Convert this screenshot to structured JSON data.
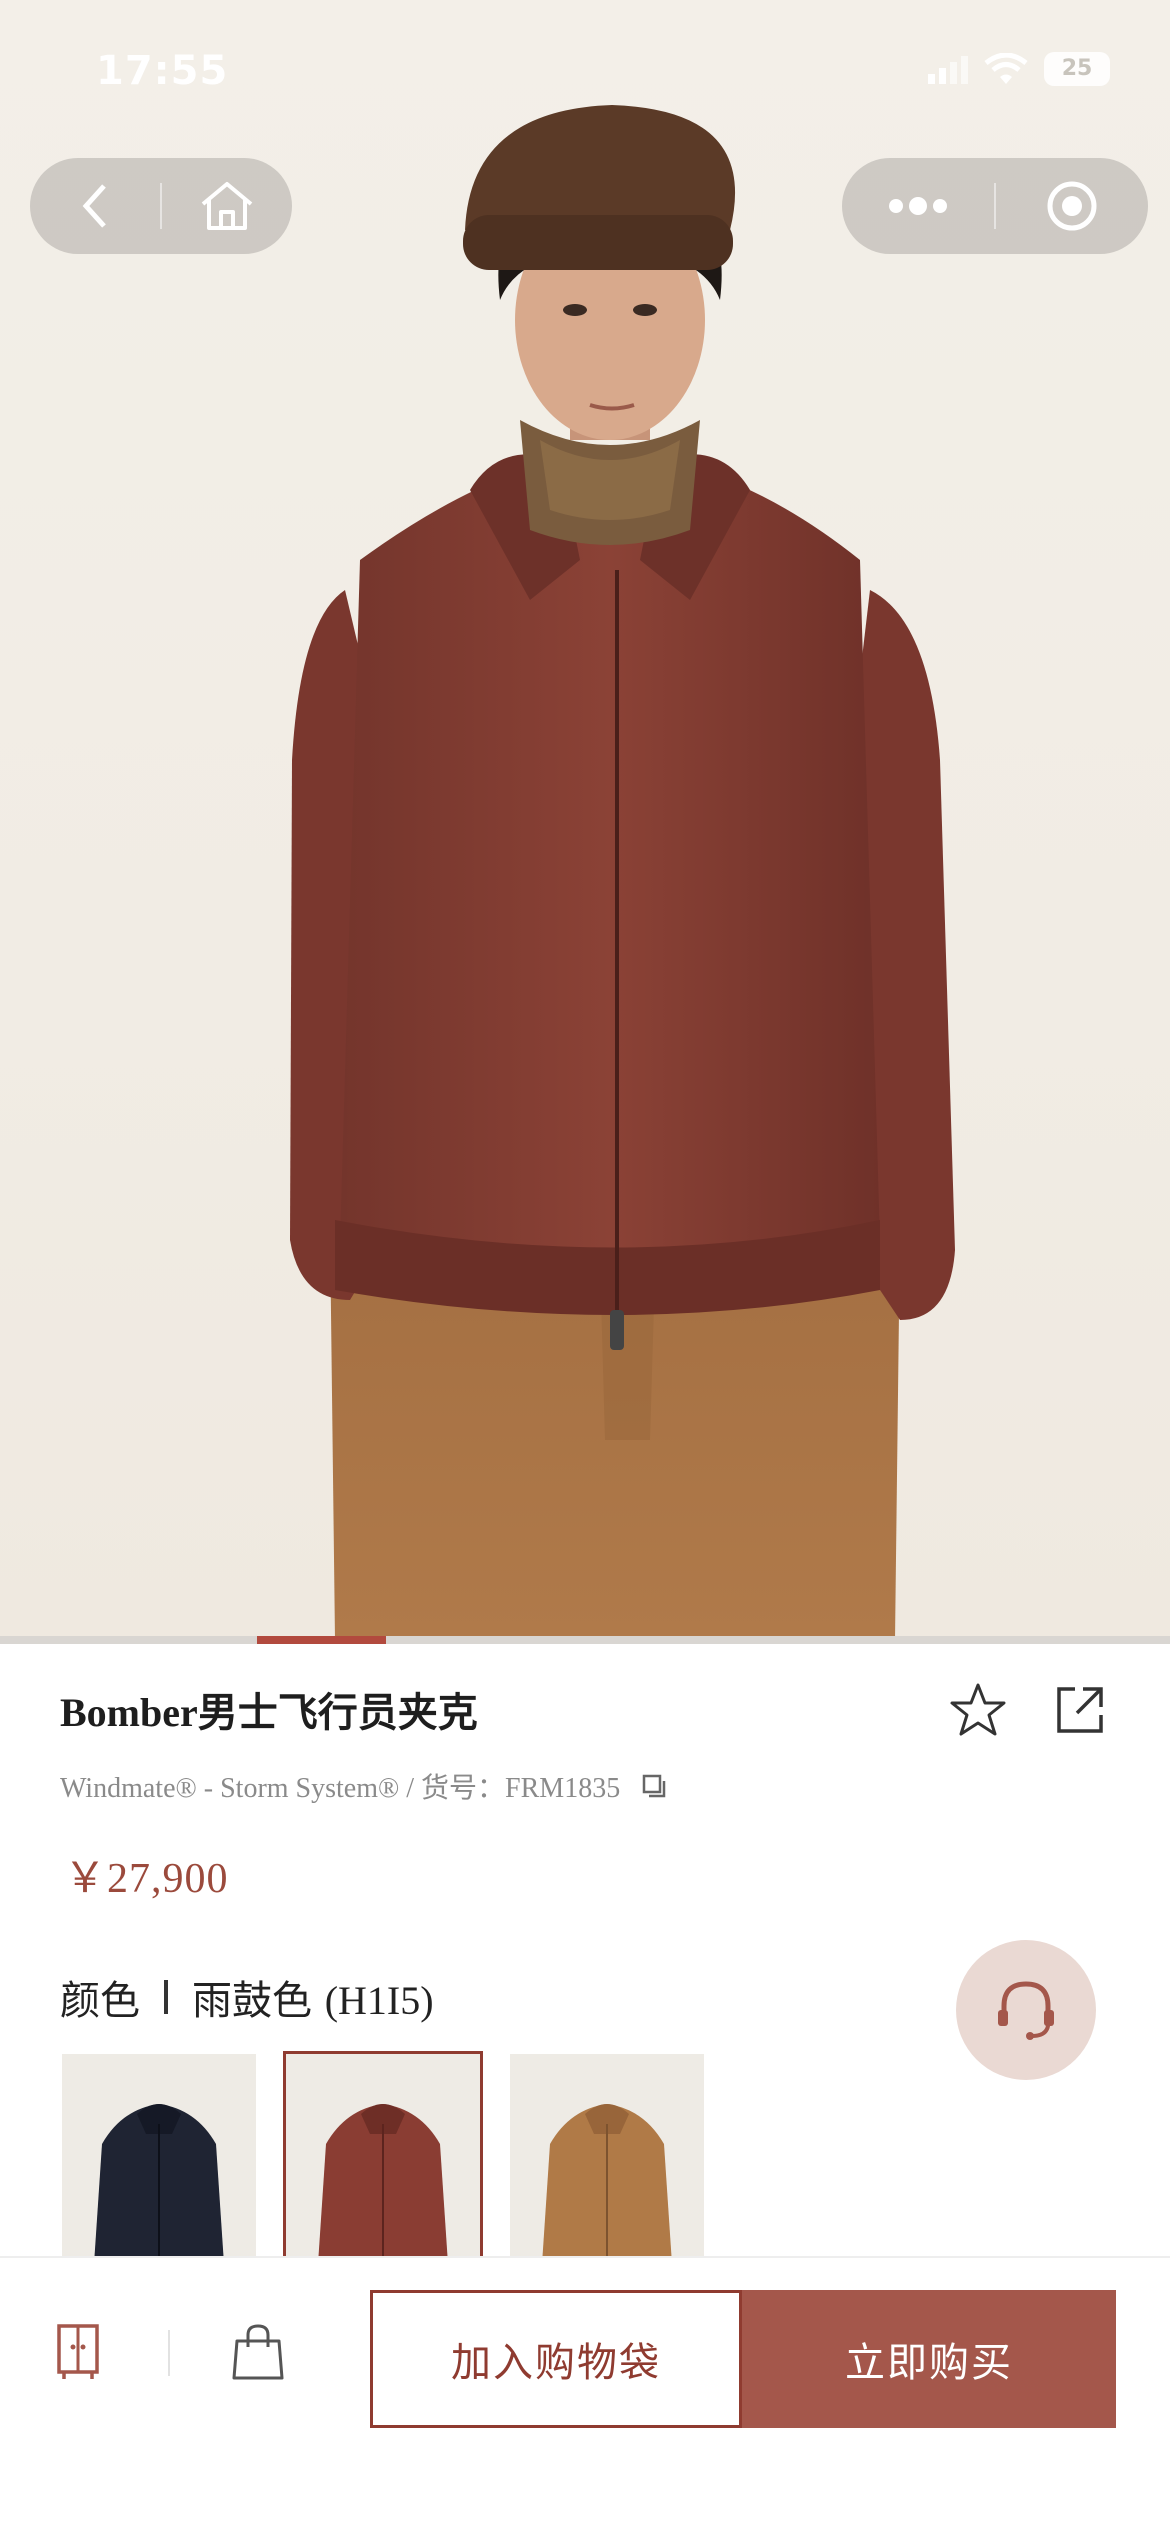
{
  "status_bar": {
    "time": "17:55",
    "battery": "25"
  },
  "nav": {
    "back_icon": "chevron-left-icon",
    "home_icon": "home-icon",
    "more_icon": "more-dots-icon",
    "close_icon": "target-close-icon"
  },
  "gallery": {
    "progress_start": 0.22,
    "progress_end": 0.33
  },
  "product": {
    "title": "Bomber男士飞行员夹克",
    "subtitle": "Windmate® - Storm System® / 货号：FRM1835",
    "price": "￥27,900",
    "favorite_icon": "star-icon",
    "share_icon": "share-icon",
    "copy_icon": "copy-icon"
  },
  "color": {
    "label": "颜色",
    "selected_name": "雨鼓色",
    "selected_code": "(H1I5)",
    "swatches": [
      {
        "color": "#1f2433",
        "selected": false
      },
      {
        "color": "#8a3d33",
        "selected": true
      },
      {
        "color": "#b07a47",
        "selected": false
      }
    ]
  },
  "customer_service_icon": "headset-icon",
  "bottom_bar": {
    "wardrobe_icon": "wardrobe-icon",
    "bag_icon": "shopping-bag-icon",
    "add_to_bag": "加入购物袋",
    "buy_now": "立即购买"
  },
  "colors": {
    "accent": "#a4574b",
    "accent_dark": "#8f3b30",
    "price": "#9b4a3c"
  }
}
